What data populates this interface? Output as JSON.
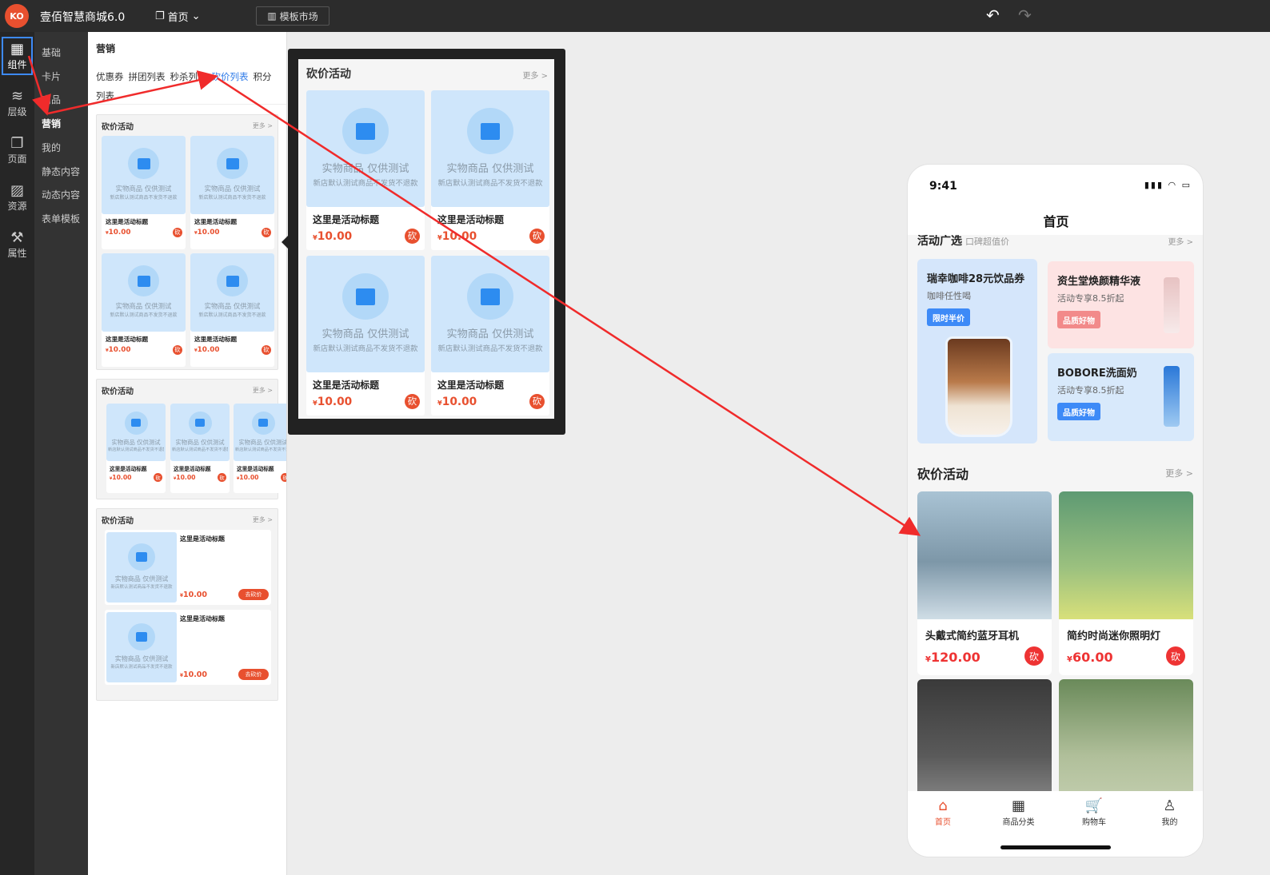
{
  "topbar": {
    "logo": "KO",
    "app_name": "壹佰智慧商城6.0",
    "nav_home": "首页",
    "template_market": "模板市场",
    "undo_icon": "undo-icon",
    "redo_icon": "redo-icon"
  },
  "iconbar": [
    {
      "label": "组件",
      "icon": "grid-icon",
      "active": true
    },
    {
      "label": "层级",
      "icon": "layers-icon"
    },
    {
      "label": "页面",
      "icon": "page-icon"
    },
    {
      "label": "资源",
      "icon": "image-icon"
    },
    {
      "label": "属性",
      "icon": "wand-icon"
    }
  ],
  "categories": [
    {
      "label": "基础"
    },
    {
      "label": "卡片"
    },
    {
      "label": "商品"
    },
    {
      "label": "营销",
      "active": true
    },
    {
      "label": "我的"
    },
    {
      "label": "静态内容"
    },
    {
      "label": "动态内容"
    },
    {
      "label": "表单模板"
    }
  ],
  "panel": {
    "title": "营销",
    "tabs": [
      {
        "label": "优惠券"
      },
      {
        "label": "拼团列表"
      },
      {
        "label": "秒杀列表"
      },
      {
        "label": "砍价列表",
        "active": true
      },
      {
        "label": "积分列表"
      }
    ],
    "product": {
      "line1": "实物商品 仅供测试",
      "line2": "新店默认测试商品不发货不退款",
      "name": "这里是活动标题",
      "price_symbol": "¥",
      "price": "10.00",
      "kan": "砍",
      "go": "去砍价"
    },
    "cards": [
      {
        "title": "砍价活动",
        "more": "更多 >"
      },
      {
        "title": "砍价活动",
        "more": "更多 >"
      },
      {
        "title": "砍价活动",
        "more": "更多 >"
      }
    ]
  },
  "popup": {
    "title": "砍价活动",
    "more": "更多 >"
  },
  "phone": {
    "time": "9:41",
    "status": "▮▮▮ ◠ ▭",
    "title": "首页",
    "section1": {
      "title": "活动广选",
      "subtitle": "口碑超值价",
      "more": "更多 >"
    },
    "promos": [
      {
        "title": "瑞幸咖啡28元饮品券",
        "sub": "咖啡任性喝",
        "badge": "限时半价",
        "color": "#d5e6fb",
        "badge_color": "#3d8af7"
      },
      {
        "title": "资生堂焕颜精华液",
        "sub": "活动专享8.5折起",
        "badge": "品质好物",
        "color": "#fde3e3",
        "badge_color": "#f28a8a"
      },
      {
        "title": "BOBORE洗面奶",
        "sub": "活动专享8.5折起",
        "badge": "品质好物",
        "color": "#d8e9fb",
        "badge_color": "#3d8af7"
      }
    ],
    "section2": {
      "title": "砍价活动",
      "more": "更多 >"
    },
    "goods": [
      {
        "name": "头戴式简约蓝牙耳机",
        "price": "120.00"
      },
      {
        "name": "简约时尚迷你照明灯",
        "price": "60.00"
      },
      {
        "name": "",
        "price": ""
      },
      {
        "name": "",
        "price": ""
      }
    ],
    "tabs": [
      {
        "label": "首页",
        "icon": "home-icon",
        "active": true
      },
      {
        "label": "商品分类",
        "icon": "grid-icon"
      },
      {
        "label": "购物车",
        "icon": "cart-icon"
      },
      {
        "label": "我的",
        "icon": "user-icon"
      }
    ]
  },
  "annotation_color": "#f02b2b"
}
